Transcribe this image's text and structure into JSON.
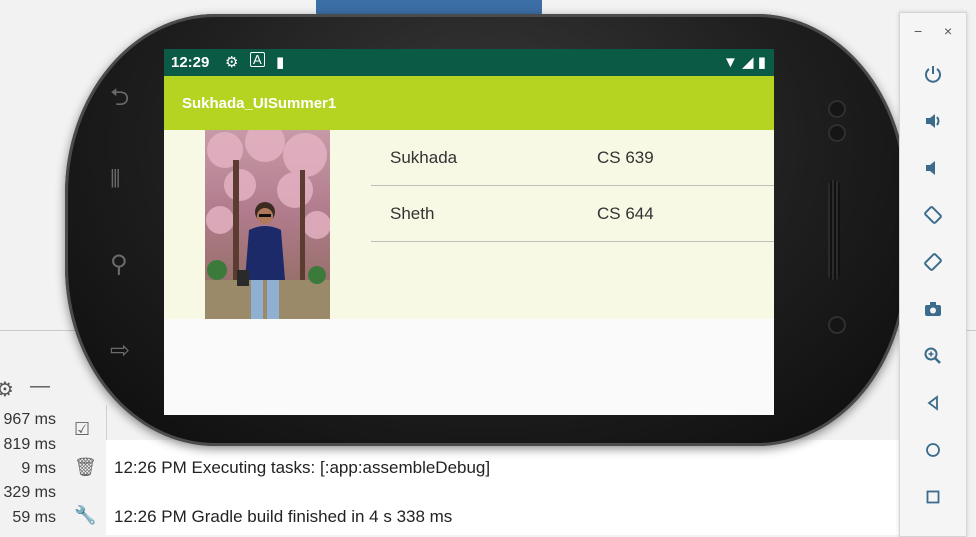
{
  "ide": {
    "times": [
      "967 ms",
      "819 ms",
      "9 ms",
      "329 ms",
      "59 ms"
    ],
    "log": [
      {
        "time": "12:26 PM",
        "message": "Executing tasks: [:app:assembleDebug]"
      },
      {
        "time": "12:26 PM",
        "message": "Gradle build finished in 4 s 338 ms"
      }
    ]
  },
  "emulator": {
    "window_controls": {
      "minimize": "−",
      "close": "×"
    },
    "controls": [
      "power-icon",
      "volume-up-icon",
      "volume-down-icon",
      "rotate-left-icon",
      "rotate-right-icon",
      "camera-icon",
      "zoom-icon",
      "back-icon",
      "home-icon",
      "overview-icon"
    ]
  },
  "device": {
    "status_bar": {
      "time": "12:29"
    },
    "app_bar": {
      "title": "Sukhada_UISummer1"
    },
    "rows": [
      {
        "name": "Sukhada",
        "course": "CS 639"
      },
      {
        "name": "Sheth",
        "course": "CS 644"
      }
    ]
  },
  "colors": {
    "status_bar": "#0b5a45",
    "app_bar": "#b5d422",
    "content_bg": "#f7f9e4",
    "emulator_icon": "#3c6c8c"
  }
}
